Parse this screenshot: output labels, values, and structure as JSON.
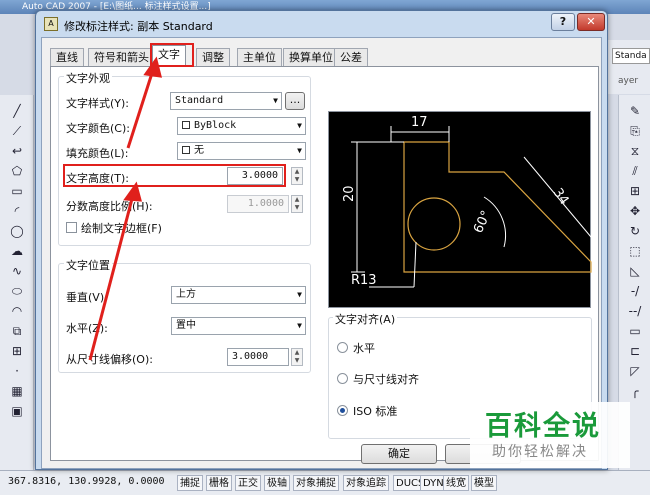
{
  "app": {
    "title_fragment": "Auto CAD 2007 - [E:\\图纸... 标注样式设置...]",
    "coordinates": "367.8316, 130.9928, 0.0000",
    "status_buttons": [
      "捕捉",
      "栅格",
      "正交",
      "极轴",
      "对象捕捉",
      "对象追踪",
      "DUCS",
      "DYN",
      "线宽",
      "模型"
    ],
    "right_style_combo": "Standa",
    "right_layer_text": "ayer"
  },
  "dialog": {
    "title": "修改标注样式: 副本 Standard",
    "help_label": "?",
    "close_label": "✕",
    "tabs": [
      "直线",
      "符号和箭头",
      "文字",
      "调整",
      "主单位",
      "换算单位",
      "公差"
    ],
    "active_tab": "文字",
    "text_appearance": {
      "group_label": "文字外观",
      "style_label": "文字样式(Y):",
      "style_value": "Standard",
      "browse_label": "...",
      "color_label": "文字颜色(C):",
      "color_value": "ByBlock",
      "fill_label": "填充颜色(L):",
      "fill_value": "无",
      "height_label": "文字高度(T):",
      "height_value": "3.0000",
      "fraction_label": "分数高度比例(H):",
      "fraction_value": "1.0000",
      "frame_label": "绘制文字边框(F)"
    },
    "text_placement": {
      "group_label": "文字位置",
      "vertical_label": "垂直(V):",
      "vertical_value": "上方",
      "horizontal_label": "水平(Z):",
      "horizontal_value": "置中",
      "offset_label": "从尺寸线偏移(O):",
      "offset_value": "3.0000"
    },
    "text_alignment": {
      "group_label": "文字对齐(A)",
      "options": [
        "水平",
        "与尺寸线对齐",
        "ISO 标准"
      ],
      "selected": "ISO 标准"
    },
    "preview": {
      "dim_top": "17",
      "dim_left": "20",
      "dim_angled": "34",
      "angle": "60°",
      "radius": "R13"
    },
    "ok_label": "确定"
  },
  "watermark": {
    "title": "百科全说",
    "subtitle": "助你轻松解决"
  },
  "colors": {
    "highlight_red": "#e0201c",
    "preview_line": "#d9a441",
    "preview_dim": "#ffffff",
    "watermark_green": "#1a9a3a"
  }
}
